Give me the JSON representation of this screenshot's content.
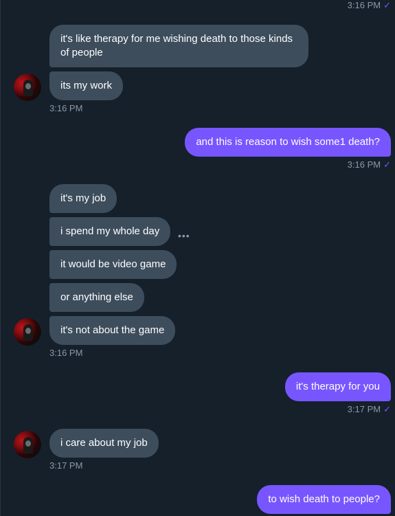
{
  "colors": {
    "background": "#15202b",
    "incoming_bubble": "#3d4d5c",
    "outgoing_bubble": "#7856ff",
    "timestamp": "#8b98a5"
  },
  "icons": {
    "check": "checkmark-icon",
    "more": "more-options-icon"
  },
  "messages": {
    "top_time": "3:16 PM",
    "m1": "it's like therapy for me wishing death to those kinds of people",
    "m2": "its my work",
    "t1": "3:16 PM",
    "m3": "and this is reason to wish some1 death?",
    "t2": "3:16 PM",
    "m4": "it's my job",
    "m5": "i spend my whole day",
    "m6": "it would be video game",
    "m7": "or anything else",
    "m8": "it's not about the game",
    "t3": "3:16 PM",
    "m9": "it's therapy for you",
    "t4": "3:17 PM",
    "m10": "i care about my job",
    "t5": "3:17 PM",
    "m11": "to wish death to people?"
  },
  "glyphs": {
    "check": "✓",
    "more": "•••"
  }
}
